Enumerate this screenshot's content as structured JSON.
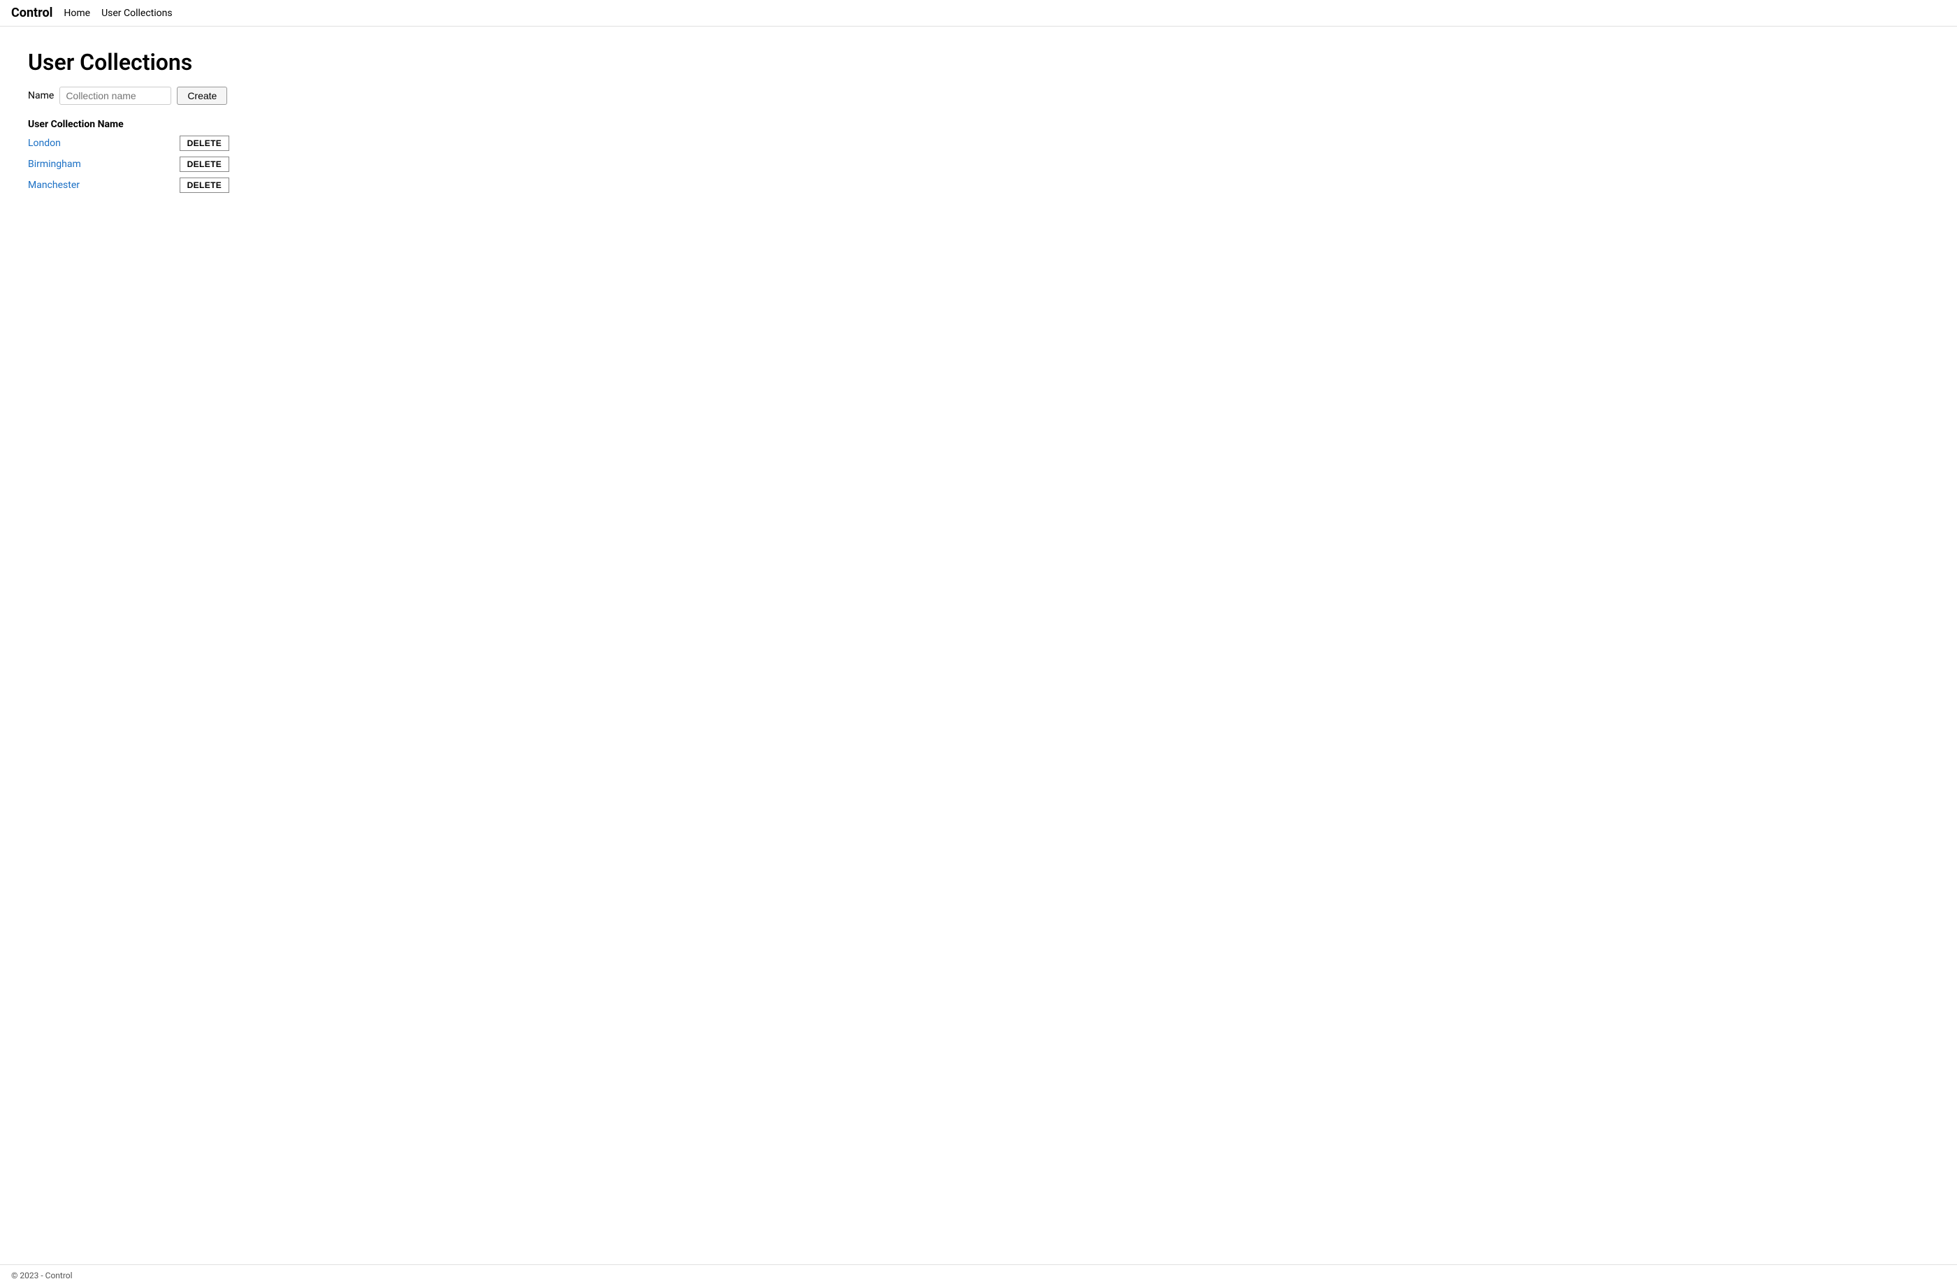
{
  "navbar": {
    "brand": "Control",
    "links": [
      {
        "label": "Home",
        "href": "#"
      },
      {
        "label": "User Collections",
        "href": "#"
      }
    ]
  },
  "page": {
    "title": "User Collections",
    "form": {
      "name_label": "Name",
      "name_placeholder": "Collection name",
      "create_button": "Create"
    },
    "table": {
      "column_header": "User Collection Name",
      "rows": [
        {
          "name": "London",
          "delete_label": "DELETE"
        },
        {
          "name": "Birmingham",
          "delete_label": "DELETE"
        },
        {
          "name": "Manchester",
          "delete_label": "DELETE"
        }
      ]
    }
  },
  "footer": {
    "text": "© 2023 - Control"
  }
}
